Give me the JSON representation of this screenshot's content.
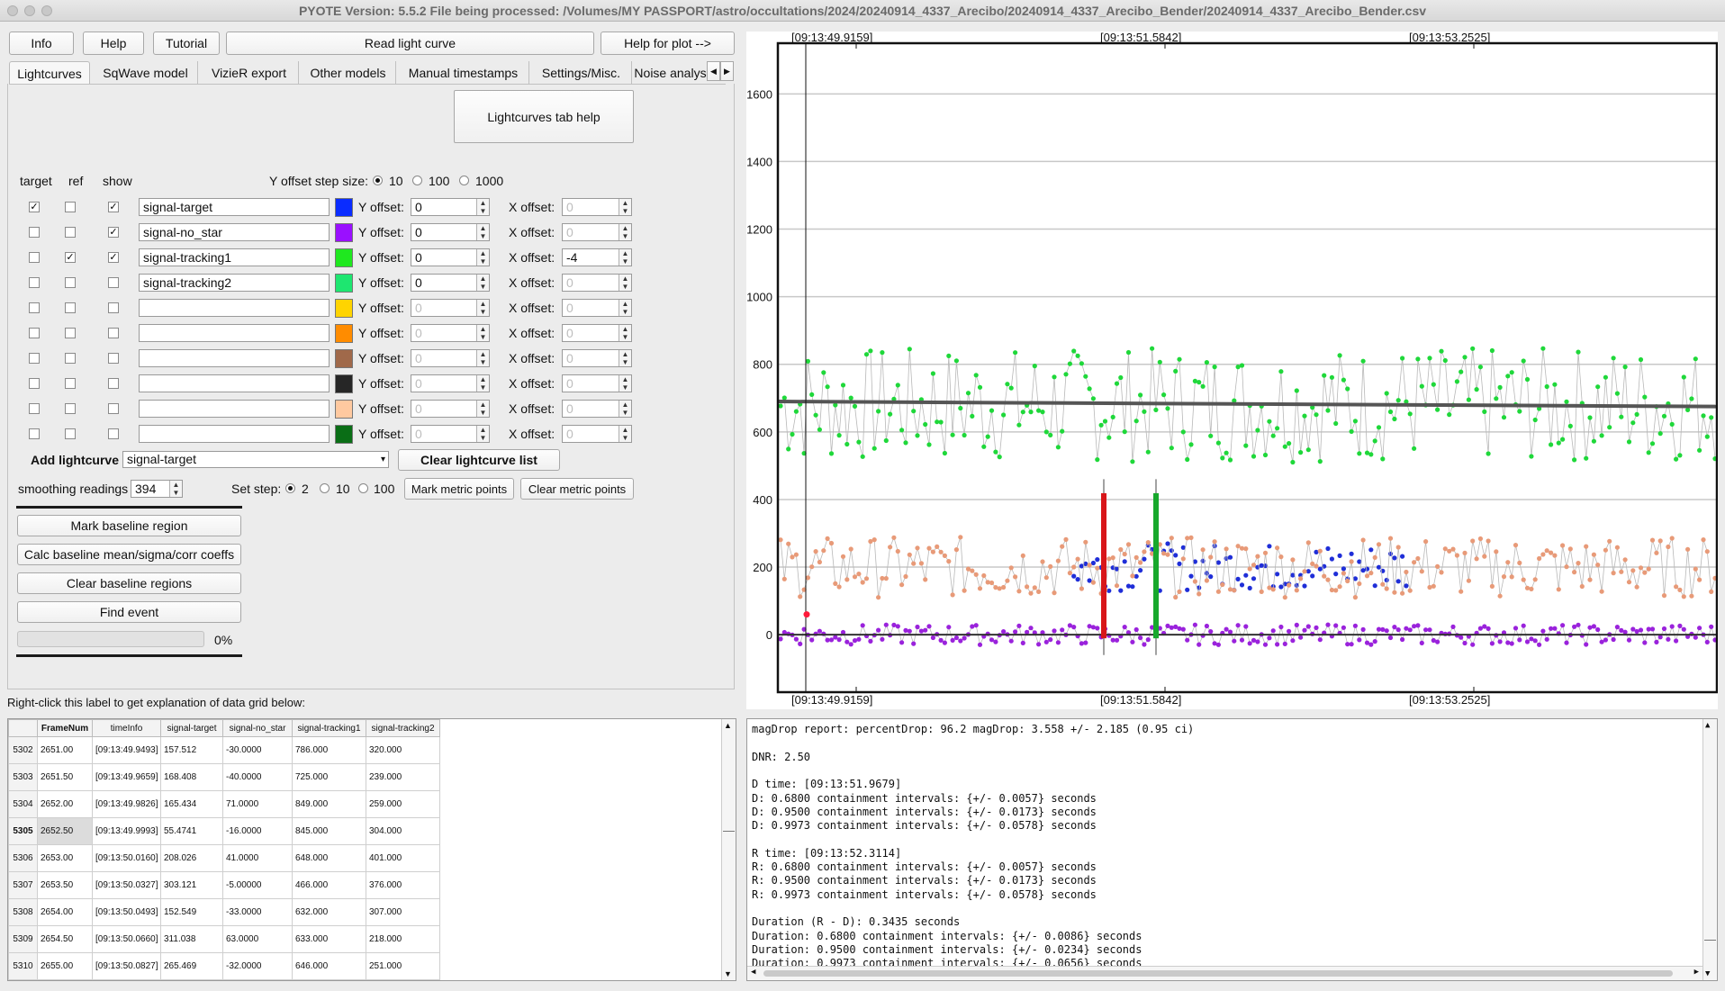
{
  "window": {
    "title": "PYOTE Version: 5.5.2  File being processed: /Volumes/MY PASSPORT/astro/occultations/2024/20240914_4337_Arecibo/20240914_4337_Arecibo_Bender/20240914_4337_Arecibo_Bender.csv"
  },
  "toolbar": {
    "info": "Info",
    "help": "Help",
    "tutorial": "Tutorial",
    "read": "Read light curve",
    "plot_help": "Help for plot -->"
  },
  "tabs": [
    "Lightcurves",
    "SqWave model",
    "VizieR export",
    "Other models",
    "Manual timestamps",
    "Settings/Misc.",
    "Noise analysis/"
  ],
  "lc": {
    "help_button": "Lightcurves tab help",
    "hdr_target": "target",
    "hdr_ref": "ref",
    "hdr_show": "show",
    "ystep_label": "Y offset step size:",
    "ystep_opts": [
      "10",
      "100",
      "1000"
    ],
    "yoff_label": "Y offset:",
    "xoff_label": "X offset:",
    "rows": [
      {
        "name": "signal-target",
        "color": "#0a2cff",
        "yoff": "0",
        "xoff": "0",
        "target": true,
        "ref": false,
        "show": true,
        "active": true,
        "xactive": false
      },
      {
        "name": "signal-no_star",
        "color": "#9a10ff",
        "yoff": "0",
        "xoff": "0",
        "target": false,
        "ref": false,
        "show": true,
        "active": true,
        "xactive": false
      },
      {
        "name": "signal-tracking1",
        "color": "#1fe81f",
        "yoff": "0",
        "xoff": "-4",
        "target": false,
        "ref": true,
        "show": true,
        "active": true,
        "xactive": true
      },
      {
        "name": "signal-tracking2",
        "color": "#1ee670",
        "yoff": "0",
        "xoff": "0",
        "target": false,
        "ref": false,
        "show": false,
        "active": true,
        "xactive": false
      },
      {
        "name": "",
        "color": "#ffd400",
        "yoff": "0",
        "xoff": "0",
        "target": false,
        "ref": false,
        "show": false,
        "active": false,
        "xactive": false
      },
      {
        "name": "",
        "color": "#ff8c00",
        "yoff": "0",
        "xoff": "0",
        "target": false,
        "ref": false,
        "show": false,
        "active": false,
        "xactive": false
      },
      {
        "name": "",
        "color": "#a0694a",
        "yoff": "0",
        "xoff": "0",
        "target": false,
        "ref": false,
        "show": false,
        "active": false,
        "xactive": false
      },
      {
        "name": "",
        "color": "#262626",
        "yoff": "0",
        "xoff": "0",
        "target": false,
        "ref": false,
        "show": false,
        "active": false,
        "xactive": false
      },
      {
        "name": "",
        "color": "#ffc9a0",
        "yoff": "0",
        "xoff": "0",
        "target": false,
        "ref": false,
        "show": false,
        "active": false,
        "xactive": false
      },
      {
        "name": "",
        "color": "#0a6e16",
        "yoff": "0",
        "xoff": "0",
        "target": false,
        "ref": false,
        "show": false,
        "active": false,
        "xactive": false
      }
    ],
    "add_label": "Add lightcurve",
    "add_value": "signal-target",
    "clear_list": "Clear lightcurve list",
    "smoothing_label": "smoothing readings",
    "smoothing_value": "394",
    "setstep_label": "Set step:",
    "setstep_opts": [
      "2",
      "10",
      "100"
    ],
    "mark_metric": "Mark metric points",
    "clear_metric": "Clear metric points",
    "mark_baseline": "Mark baseline region",
    "calc_baseline": "Calc baseline mean/sigma/corr coeffs",
    "clear_baseline": "Clear baseline regions",
    "find_event": "Find event",
    "progress_pct": "0%",
    "progress_value": 0
  },
  "grid_label": "Right-click this label to get explanation of data grid below:",
  "grid": {
    "columns": [
      "FrameNum",
      "timeInfo",
      "signal-target",
      "signal-no_star",
      "signal-tracking1",
      "signal-tracking2"
    ],
    "rows": [
      [
        "5302",
        "2651.00",
        "[09:13:49.9493]",
        "157.512",
        "-30.0000",
        "786.000",
        "320.000"
      ],
      [
        "5303",
        "2651.50",
        "[09:13:49.9659]",
        "168.408",
        "-40.0000",
        "725.000",
        "239.000"
      ],
      [
        "5304",
        "2652.00",
        "[09:13:49.9826]",
        "165.434",
        "71.0000",
        "849.000",
        "259.000"
      ],
      [
        "5305",
        "2652.50",
        "[09:13:49.9993]",
        "55.4741",
        "-16.0000",
        "845.000",
        "304.000"
      ],
      [
        "5306",
        "2653.00",
        "[09:13:50.0160]",
        "208.026",
        "41.0000",
        "648.000",
        "401.000"
      ],
      [
        "5307",
        "2653.50",
        "[09:13:50.0327]",
        "303.121",
        "-5.00000",
        "466.000",
        "376.000"
      ],
      [
        "5308",
        "2654.00",
        "[09:13:50.0493]",
        "152.549",
        "-33.0000",
        "632.000",
        "307.000"
      ],
      [
        "5309",
        "2654.50",
        "[09:13:50.0660]",
        "311.038",
        "63.0000",
        "633.000",
        "218.000"
      ],
      [
        "5310",
        "2655.00",
        "[09:13:50.0827]",
        "265.469",
        "-32.0000",
        "646.000",
        "251.000"
      ]
    ]
  },
  "report": [
    "magDrop report: percentDrop: 96.2 magDrop: 3.558 +/- 2.185 (0.95 ci)",
    "",
    "DNR: 2.50",
    "",
    "D time: [09:13:51.9679]",
    "D: 0.6800 containment intervals: {+/- 0.0057} seconds",
    "D: 0.9500 containment intervals: {+/- 0.0173} seconds",
    "D: 0.9973 containment intervals: {+/- 0.0578} seconds",
    "",
    "R time: [09:13:52.3114]",
    "R: 0.6800 containment intervals: {+/- 0.0057} seconds",
    "R: 0.9500 containment intervals: {+/- 0.0173} seconds",
    "R: 0.9973 containment intervals: {+/- 0.0578} seconds",
    "",
    "Duration (R - D): 0.3435 seconds",
    "Duration: 0.6800 containment intervals: {+/- 0.0086} seconds",
    "Duration: 0.9500 containment intervals: {+/- 0.0234} seconds",
    "Duration: 0.9973 containment intervals: {+/- 0.0656} seconds"
  ],
  "chart_data": {
    "type": "scatter",
    "ylim": [
      -170,
      1750
    ],
    "yticks": [
      0,
      200,
      400,
      600,
      800,
      1000,
      1200,
      1400,
      1600
    ],
    "xticks": [
      "[09:13:49.9159]",
      "[09:13:51.5842]",
      "[09:13:53.2525]"
    ],
    "grid": true,
    "cursor_at": "[09:13:49.9159]",
    "series": [
      {
        "name": "signal-tracking1",
        "color": "#1fd83a",
        "kind": "points+line",
        "level": 680,
        "spread": 170
      },
      {
        "name": "signal-target",
        "color": "#1f2ed8",
        "kind": "points",
        "level": 200,
        "spread": 70
      },
      {
        "name": "signal-target",
        "color": "#e89a78",
        "kind": "points+line",
        "level": 200,
        "spread": 90
      },
      {
        "name": "signal-no_star",
        "color": "#9a22dc",
        "kind": "points+line",
        "level": 0,
        "spread": 30
      }
    ],
    "baseline_fit": {
      "start": 690,
      "end": 675,
      "color": "#555555"
    },
    "events": [
      {
        "label": "D",
        "color": "#d8161a",
        "from": 0,
        "to": 410
      },
      {
        "label": "R",
        "color": "#17a82c",
        "from": 0,
        "to": 410
      }
    ]
  }
}
